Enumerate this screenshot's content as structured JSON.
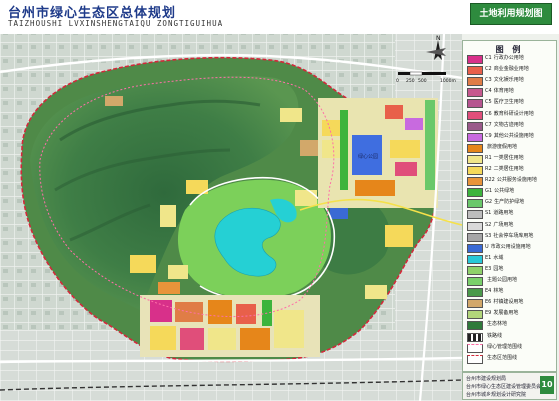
{
  "header": {
    "title_cn": "台州市绿心生态区总体规划",
    "title_en": "TAIZHOUSHI LVXINSHENGTAIQU ZONGTIGUIHUA",
    "sheet_name": "土地利用规划图"
  },
  "map": {
    "north_label": "N",
    "scale_labels": [
      "0",
      "250",
      "500",
      "1000m"
    ],
    "place_labels": [
      "绿心公园"
    ]
  },
  "legend": {
    "title": "图  例",
    "items": [
      {
        "code": "C1",
        "label": "行政办公用地",
        "color": "#d8308a"
      },
      {
        "code": "C2",
        "label": "商业金融业用地",
        "color": "#e8604a"
      },
      {
        "code": "C3",
        "label": "文化娱乐用地",
        "color": "#e07d46"
      },
      {
        "code": "C4",
        "label": "体育用地",
        "color": "#c65a8e"
      },
      {
        "code": "C5",
        "label": "医疗卫生用地",
        "color": "#b6558f"
      },
      {
        "code": "C6",
        "label": "教育科研设计用地",
        "color": "#e04e7a"
      },
      {
        "code": "C7",
        "label": "文物古迹用地",
        "color": "#9a5a8a"
      },
      {
        "code": "C9",
        "label": "其他公共设施用地",
        "color": "#c86adf"
      },
      {
        "code": "",
        "label": "旅游度假用地",
        "color": "#e6861a"
      },
      {
        "code": "R1",
        "label": "一类居住用地",
        "color": "#f0e68a"
      },
      {
        "code": "R2",
        "label": "二类居住用地",
        "color": "#f5d95a"
      },
      {
        "code": "R22",
        "label": "公共服务设施用地",
        "color": "#e8943a"
      },
      {
        "code": "G1",
        "label": "公共绿地",
        "color": "#3cb43c"
      },
      {
        "code": "G2",
        "label": "生产防护绿地",
        "color": "#6ac86a"
      },
      {
        "code": "S1",
        "label": "道路用地",
        "color": "#bdbdbd"
      },
      {
        "code": "S2",
        "label": "广场用地",
        "color": "#d9d9d9"
      },
      {
        "code": "S3",
        "label": "社会停车场库用地",
        "color": "#a6a6a6"
      },
      {
        "code": "U",
        "label": "市政公用设施用地",
        "color": "#3a6ad4"
      },
      {
        "code": "E1",
        "label": "水域",
        "color": "#28c8d8"
      },
      {
        "code": "E3",
        "label": "园地",
        "color": "#8fd16a"
      },
      {
        "code": "",
        "label": "主题公园用地",
        "color": "#7ad06a"
      },
      {
        "code": "E4",
        "label": "林地",
        "color": "#4a9a4a"
      },
      {
        "code": "E6",
        "label": "村镇建设用地",
        "color": "#d2a86a"
      },
      {
        "code": "E9",
        "label": "发展备用地",
        "color": "#b2d67a"
      },
      {
        "code": "",
        "label": "生态林地",
        "color": "#2f7a3a"
      },
      {
        "code": "",
        "label": "铁路线",
        "color": "#ffffff"
      },
      {
        "code": "",
        "label": "绿心管理范围线",
        "color": "#ffffff"
      },
      {
        "code": "",
        "label": "生态区范围线",
        "color": "#ffffff"
      }
    ]
  },
  "info": {
    "org_1": "台州市建设规划局",
    "org_2": "台州市绿心生态区建设管理委员会",
    "org_3": "台州市城乡规划设计研究院",
    "page_number": "10"
  }
}
